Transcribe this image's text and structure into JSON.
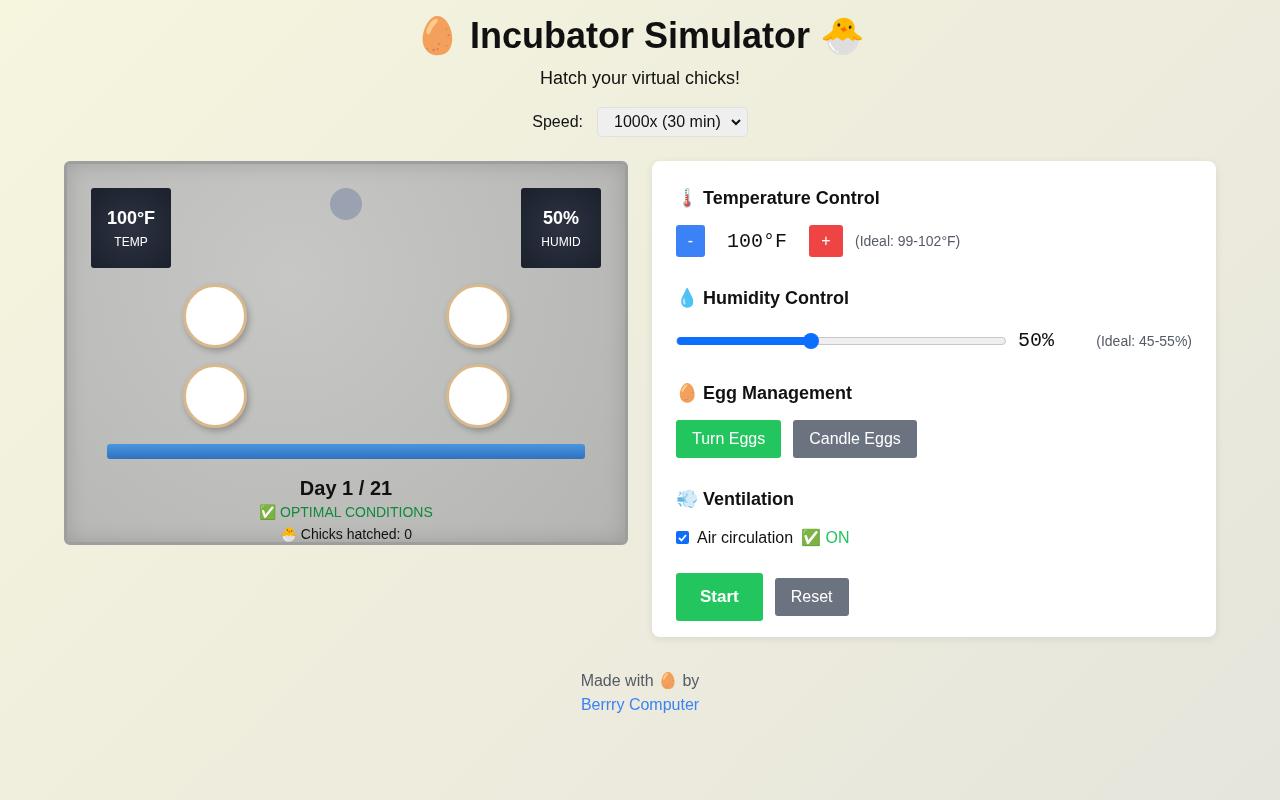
{
  "header": {
    "title": "🥚 Incubator Simulator 🐣",
    "subtitle": "Hatch your virtual chicks!",
    "speed_label": "Speed:",
    "speed_value": "1000x (30 min)"
  },
  "incubator": {
    "temp_display": {
      "value": "100°F",
      "label": "TEMP"
    },
    "humid_display": {
      "value": "50%",
      "label": "HUMID"
    },
    "eggs": [
      {
        "kind": "egg"
      },
      {
        "kind": "egg"
      },
      {
        "kind": "egg"
      },
      {
        "kind": "egg"
      }
    ],
    "day": "Day 1 / 21",
    "status": "✅ OPTIMAL CONDITIONS",
    "hatched": "🐣 Chicks hatched: 0"
  },
  "controls": {
    "temperature": {
      "heading": "🌡️ Temperature Control",
      "minus": "-",
      "value": "100°F",
      "plus": "+",
      "ideal": "(Ideal: 99-102°F)"
    },
    "humidity": {
      "heading": "💧 Humidity Control",
      "level": 0.41,
      "value": "50%",
      "ideal": "(Ideal: 45-55%)"
    },
    "eggs": {
      "heading": "🥚 Egg Management",
      "buttons": [
        {
          "label": "Turn Eggs",
          "kind": "primary"
        },
        {
          "label": "Candle Eggs",
          "kind": "secondary"
        }
      ]
    },
    "ventilation": {
      "heading": "💨 Ventilation",
      "label": "Air circulation",
      "checked": true,
      "state": "✅ ON"
    },
    "actions": [
      {
        "label": "Start",
        "kind": "primary"
      },
      {
        "label": "Reset",
        "kind": "secondary"
      }
    ]
  },
  "footer": {
    "text": "Made with 🥚 by",
    "link": "Berrry Computer"
  }
}
